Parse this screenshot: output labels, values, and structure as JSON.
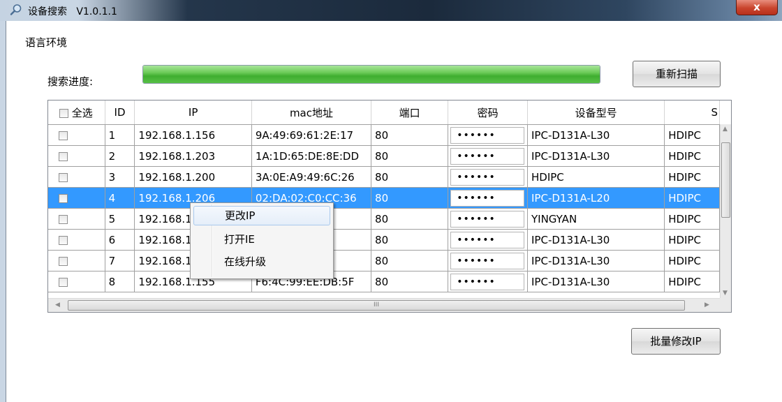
{
  "window": {
    "title": "设备搜索   V1.0.1.1",
    "icon": "search-icon",
    "close_label": "x"
  },
  "menu": {
    "language": "语言环境"
  },
  "progress": {
    "label": "搜索进度:",
    "value_percent": 100,
    "color": "#4cb83a"
  },
  "buttons": {
    "rescan": "重新扫描",
    "batch_modify": "批量修改IP"
  },
  "table": {
    "headers": {
      "select_all": "全选",
      "id": "ID",
      "ip": "IP",
      "mac": "mac地址",
      "port": "端口",
      "password": "密码",
      "model": "设备型号",
      "last": "S"
    },
    "rows": [
      {
        "id": "1",
        "ip": "192.168.1.156",
        "mac": "9A:49:69:61:2E:17",
        "port": "80",
        "password": "••••••",
        "model": "IPC-D131A-L30",
        "last": "HDIPC"
      },
      {
        "id": "2",
        "ip": "192.168.1.203",
        "mac": "1A:1D:65:DE:8E:DD",
        "port": "80",
        "password": "••••••",
        "model": "IPC-D131A-L30",
        "last": "HDIPC"
      },
      {
        "id": "3",
        "ip": "192.168.1.200",
        "mac": "3A:0E:A9:49:6C:26",
        "port": "80",
        "password": "••••••",
        "model": "HDIPC",
        "last": "HDIPC"
      },
      {
        "id": "4",
        "ip": "192.168.1.206",
        "mac": "02:DA:02:C0:CC:36",
        "port": "80",
        "password": "••••••",
        "model": "IPC-D131A-L20",
        "last": "HDIPC"
      },
      {
        "id": "5",
        "ip": "192.168.1",
        "mac": "0:6E",
        "port": "80",
        "password": "••••••",
        "model": "YINGYAN",
        "last": "HDIPC"
      },
      {
        "id": "6",
        "ip": "192.168.1",
        "mac": "3:4D",
        "port": "80",
        "password": "••••••",
        "model": "IPC-D131A-L30",
        "last": "HDIPC"
      },
      {
        "id": "7",
        "ip": "192.168.1",
        "mac": "39:FA",
        "port": "80",
        "password": "••••••",
        "model": "IPC-D131A-L30",
        "last": "HDIPC"
      },
      {
        "id": "8",
        "ip": "192.168.1.155",
        "mac": "F6:4C:99:EE:DB:5F",
        "port": "80",
        "password": "••••••",
        "model": "IPC-D131A-L30",
        "last": "HDIPC"
      }
    ],
    "selected_row": 4,
    "hscroll_grip": "III"
  },
  "context_menu": {
    "items": [
      "更改IP",
      "打开IE",
      "在线升级"
    ],
    "highlighted": 0
  }
}
